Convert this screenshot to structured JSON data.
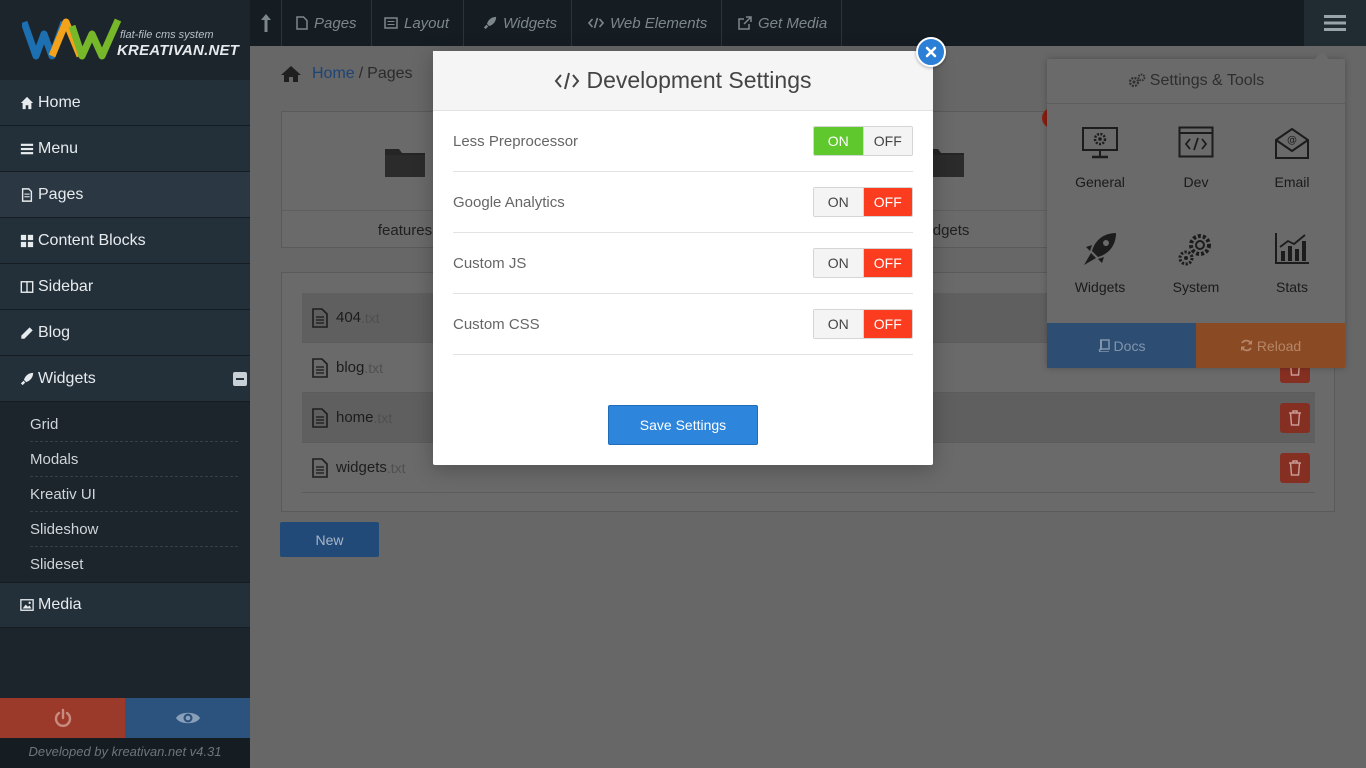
{
  "brand": {
    "tagline": "flat-file cms system",
    "name": "KREATIVAN.NET"
  },
  "sidebar": {
    "items": [
      {
        "label": "Home",
        "icon": "home-icon"
      },
      {
        "label": "Menu",
        "icon": "bars-icon"
      },
      {
        "label": "Pages",
        "icon": "file-icon"
      },
      {
        "label": "Content Blocks",
        "icon": "th-large-icon"
      },
      {
        "label": "Sidebar",
        "icon": "columns-icon"
      },
      {
        "label": "Blog",
        "icon": "pencil-icon"
      },
      {
        "label": "Widgets",
        "icon": "rocket-icon"
      }
    ],
    "widget_items": [
      "Grid",
      "Modals",
      "Kreativ UI",
      "Slideshow",
      "Slideset"
    ],
    "media_label": "Media",
    "credit": "Developed by kreativan.net v4.31"
  },
  "topbar": {
    "links": [
      "Pages",
      "Layout",
      "Widgets",
      "Web Elements",
      "Get Media"
    ]
  },
  "breadcrumb": {
    "home": "Home",
    "separator": "/",
    "current": "Pages"
  },
  "folders": [
    "features",
    "widgets"
  ],
  "files": [
    {
      "name": "404",
      "ext": ".txt"
    },
    {
      "name": "blog",
      "ext": ".txt"
    },
    {
      "name": "home",
      "ext": ".txt"
    },
    {
      "name": "widgets",
      "ext": ".txt"
    }
  ],
  "new_button": "New",
  "tools_panel": {
    "title": "Settings & Tools",
    "tools": [
      "General",
      "Dev",
      "Email",
      "Widgets",
      "System",
      "Stats"
    ],
    "docs": "Docs",
    "reload": "Reload"
  },
  "modal": {
    "title": "Development Settings",
    "settings": [
      {
        "label": "Less Preprocessor",
        "on": "ON",
        "off": "OFF",
        "state": "on"
      },
      {
        "label": "Google Analytics",
        "on": "ON",
        "off": "OFF",
        "state": "off"
      },
      {
        "label": "Custom JS",
        "on": "ON",
        "off": "OFF",
        "state": "off"
      },
      {
        "label": "Custom CSS",
        "on": "ON",
        "off": "OFF",
        "state": "off"
      }
    ],
    "save": "Save Settings"
  },
  "colors": {
    "on": "#5fc82d",
    "off": "#fb3c1f",
    "primary": "#2d85dc"
  }
}
